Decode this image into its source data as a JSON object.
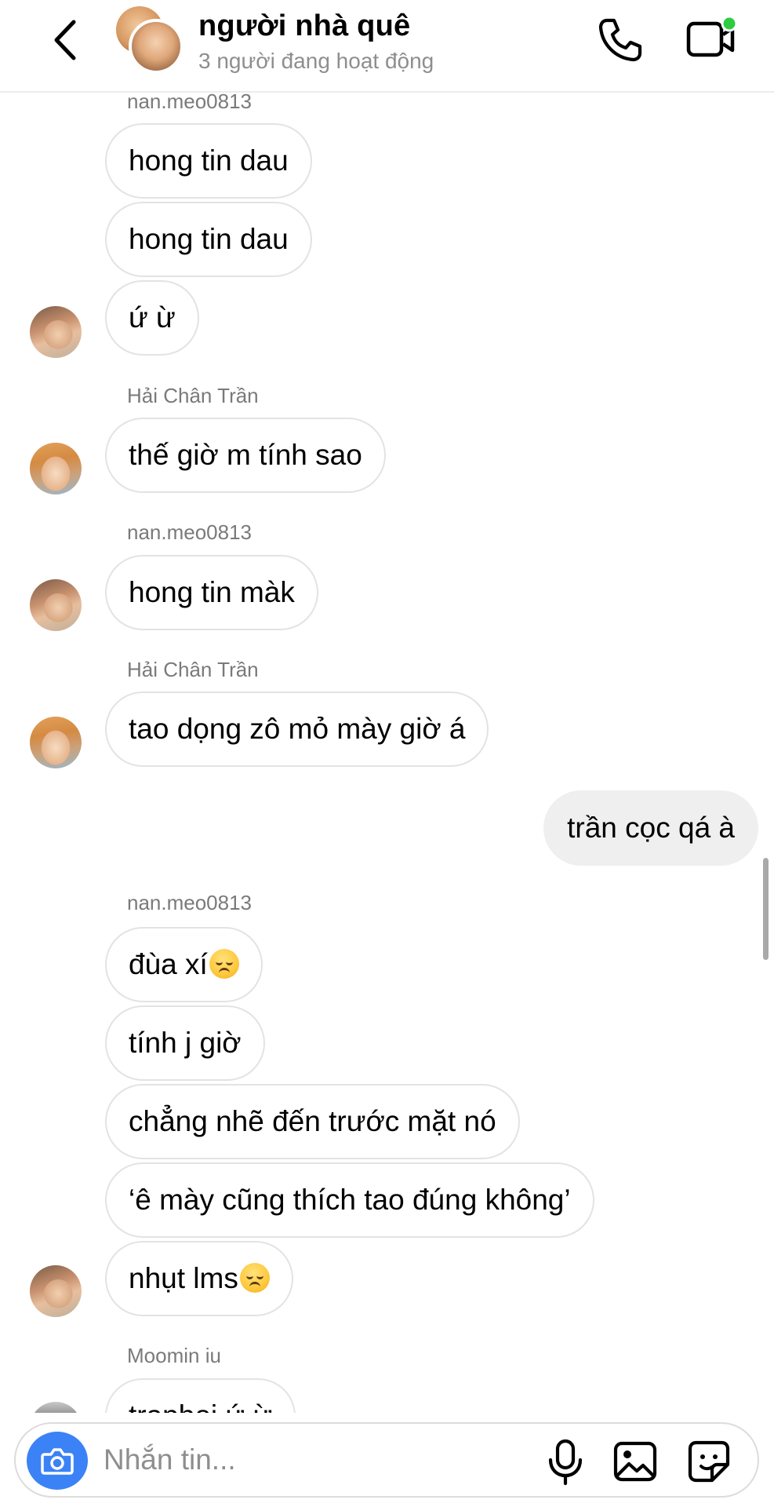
{
  "header": {
    "title": "người nhà quê",
    "subtitle": "3 người đang hoạt động",
    "online_color": "#2ecc40"
  },
  "messages": [
    {
      "sender": "nan.meo0813",
      "lines": [
        "hong tin dau",
        "hong tin dau",
        "ứ ừ"
      ]
    },
    {
      "sender": "Hải Chân Trần",
      "lines": [
        "thế giờ m tính sao"
      ]
    },
    {
      "sender": "nan.meo0813",
      "lines": [
        "hong tin màk"
      ]
    },
    {
      "sender": "Hải Chân Trần",
      "lines": [
        "tao dọng zô mỏ mày giờ á"
      ]
    },
    {
      "sender": "me",
      "lines": [
        "trần cọc qá à"
      ]
    },
    {
      "sender": "nan.meo0813",
      "lines": [
        "đùa xí",
        "tính j giờ",
        "chẳng nhẽ đến trước mặt nó",
        "‘ê mày cũng thích tao đúng không’",
        "nhụt lms"
      ]
    },
    {
      "sender": "Moomin iu",
      "lines": [
        "trapboi ứ ừ"
      ]
    }
  ],
  "composer": {
    "placeholder": "Nhắn tin...",
    "accent": "#3b82f6"
  }
}
